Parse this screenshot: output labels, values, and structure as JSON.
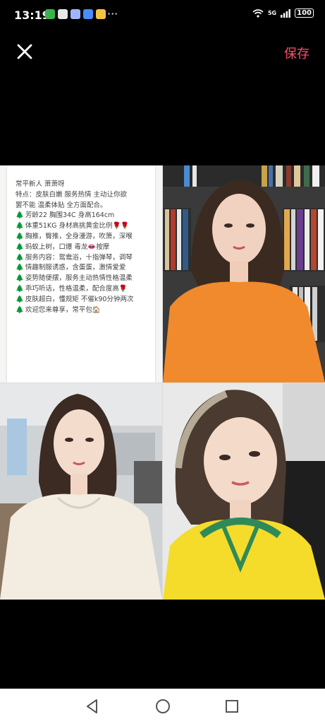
{
  "status": {
    "time": "13:19",
    "more": "···",
    "network": "5G",
    "battery": "100"
  },
  "topbar": {
    "save_label": "保存"
  },
  "note": {
    "lines": [
      "常平新人 萧萧呀",
      "特点：皮肤白嫩 服务热情 主动让你欲",
      "罢不能 温柔体贴 全方面配合。",
      "芳龄22 胸围34C 身高164cm",
      "体重51KG 身材高挑黄金比例🌹🌹",
      "胸推，臀推，全身漫游，吹箫，深喉",
      "蚂蚁上树，口爆 毒龙👄按摩",
      "服务内容：鸳鸯浴，十指弹琴，调琴",
      "情趣制服诱惑，含蛋蛋，激情爱爱",
      "姿势随便摆，服务主动热情性格温柔",
      "乖巧听话，性格温柔，配合度高🌹",
      "皮肤超白，懂规矩 不催k90分钟两次",
      "欢迎您来尊享，常平包🏠"
    ],
    "tree_icon": "🌲"
  },
  "icons": {
    "close": "close-icon",
    "back": "back-triangle-icon",
    "home": "home-circle-icon",
    "recents": "recents-square-icon"
  },
  "colors": {
    "accent": "#ff4d6a",
    "background": "#000000"
  }
}
